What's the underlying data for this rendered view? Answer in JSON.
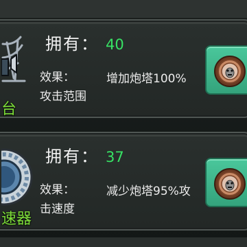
{
  "cards": [
    {
      "item_name": "台",
      "own_label": "拥有：",
      "own_value": "40",
      "effect_label": "效果：",
      "effect_text": "增加炮塔100%攻击范围",
      "icon": "radar-turret-icon",
      "button_icon": "coin-icon"
    },
    {
      "item_name": "速器",
      "own_label": "拥有：",
      "own_value": "37",
      "effect_label": "效果：",
      "effect_text": "减少炮塔95%攻击速度",
      "icon": "accelerator-gear-icon",
      "button_icon": "coin-icon"
    }
  ],
  "colors": {
    "accent_green": "#37e264",
    "name_green": "#7ddb3a",
    "button_teal": "#3fb78c"
  }
}
